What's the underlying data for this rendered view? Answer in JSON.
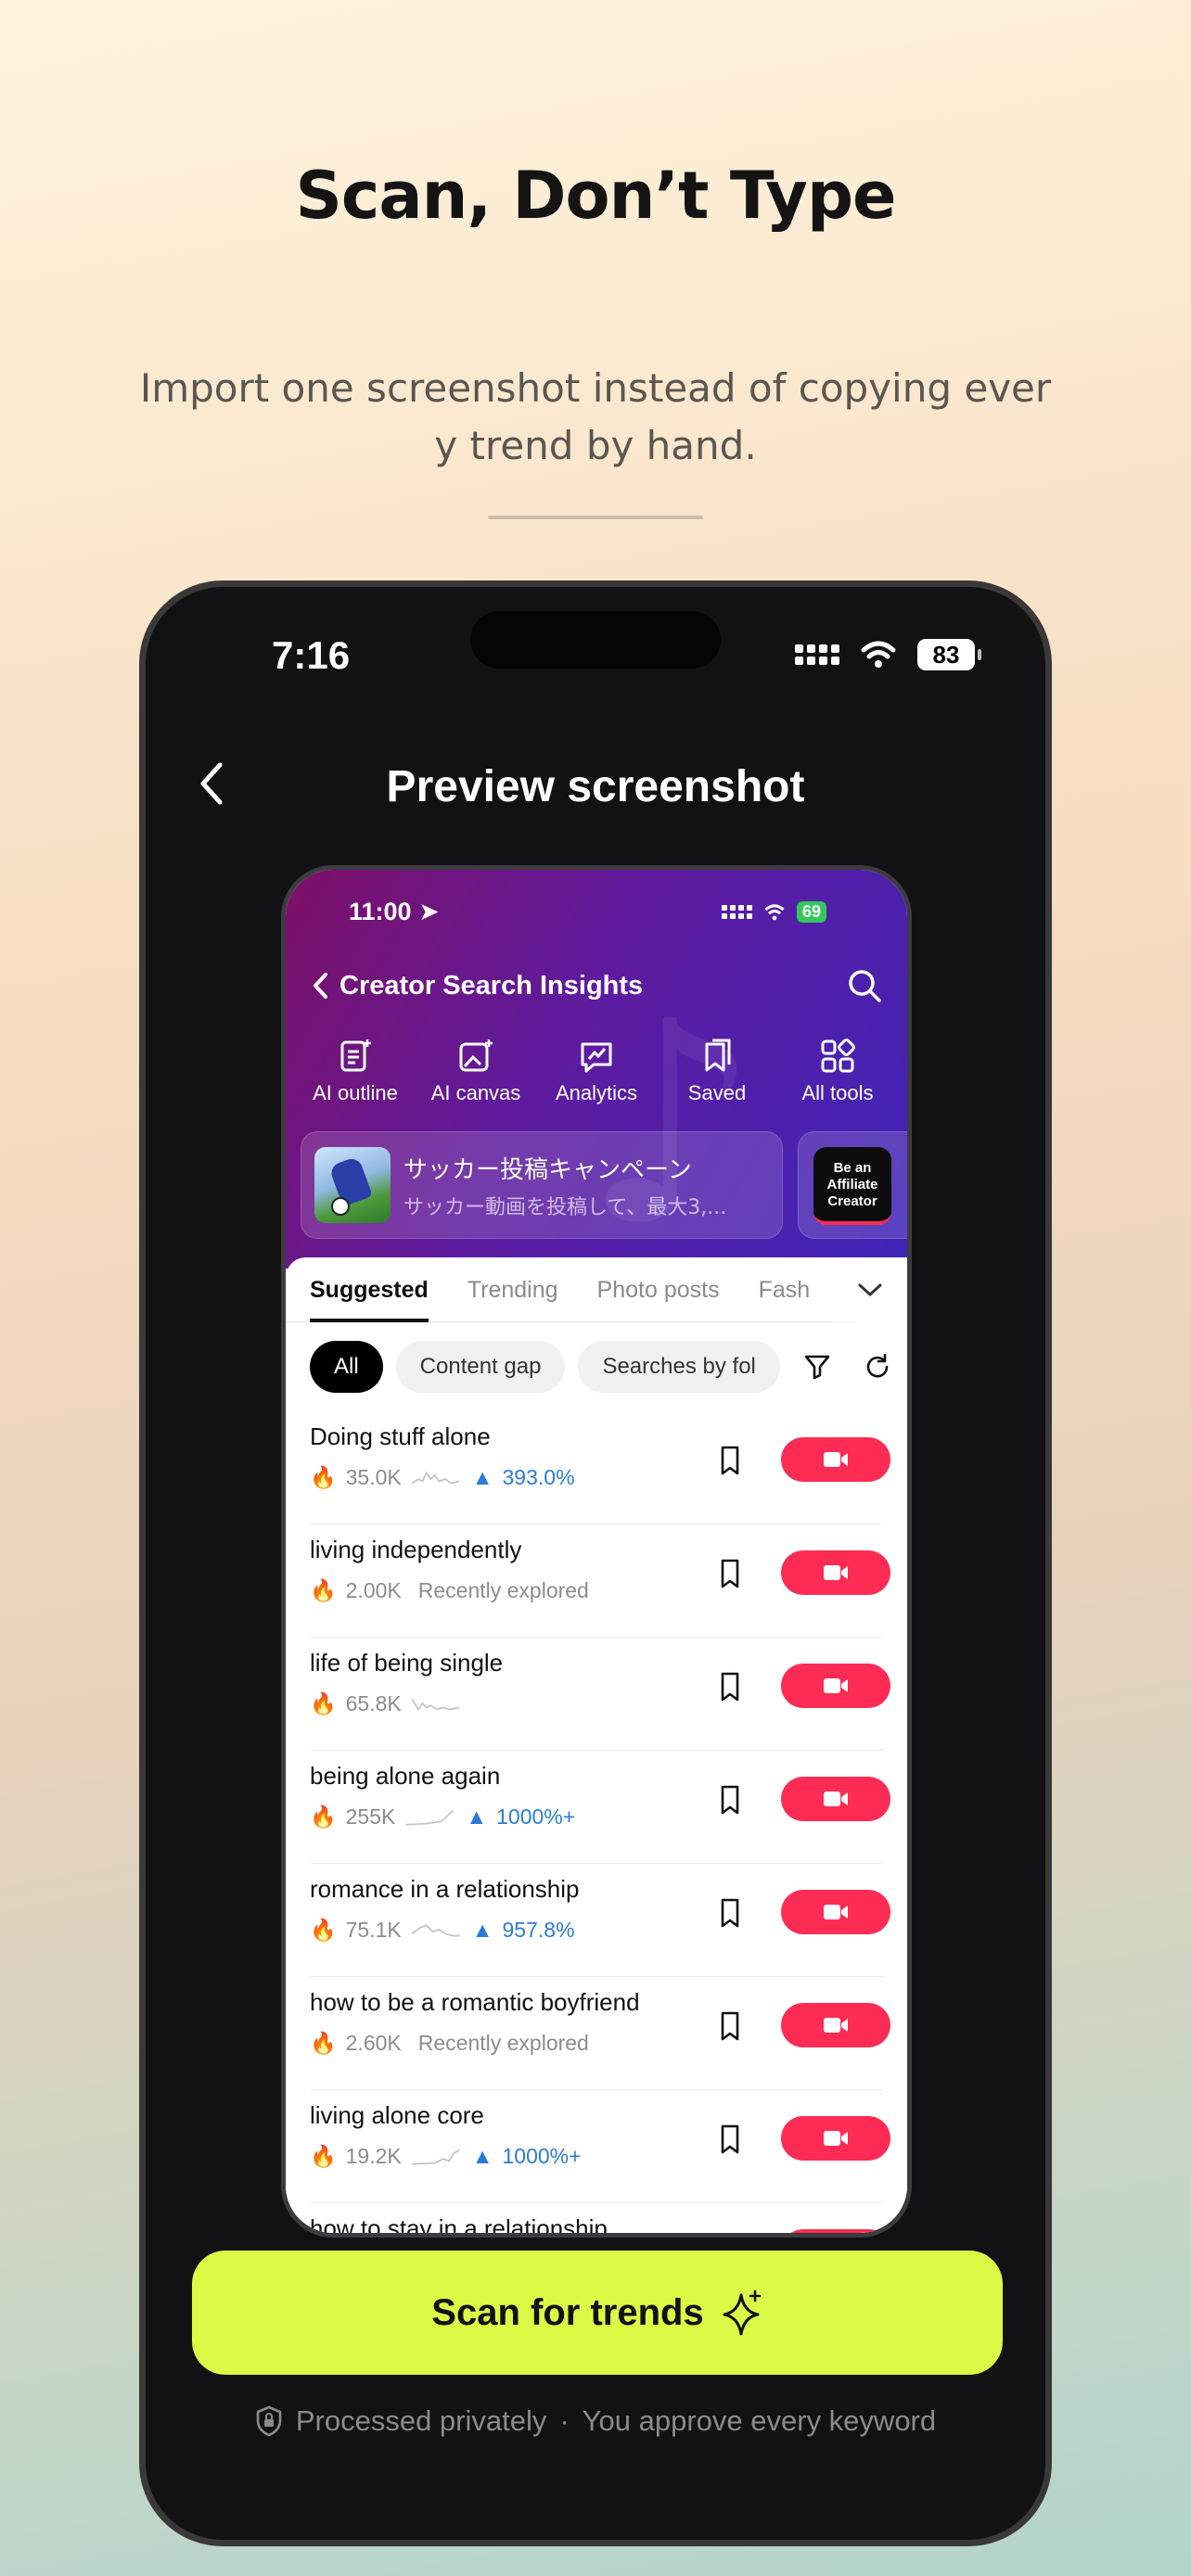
{
  "marketing": {
    "headline": "Scan, Don’t Type",
    "subhead": "Import one screenshot instead of copying every trend by hand."
  },
  "phone": {
    "time": "7:16",
    "battery": "83",
    "title": "Preview screenshot"
  },
  "screenshot": {
    "time": "11:00",
    "battery": "69",
    "title": "Creator Search Insights",
    "tools": [
      {
        "label": "AI outline",
        "icon": "ai-outline-icon"
      },
      {
        "label": "AI canvas",
        "icon": "ai-canvas-icon"
      },
      {
        "label": "Analytics",
        "icon": "analytics-icon"
      },
      {
        "label": "Saved",
        "icon": "saved-icon"
      },
      {
        "label": "All tools",
        "icon": "all-tools-icon"
      }
    ],
    "banner": {
      "title": "サッカー投稿キャンペーン",
      "subtitle": "サッカー動画を投稿して、最大3,..."
    },
    "banner2_text": "Be an Affiliate Creator",
    "tabs": [
      "Suggested",
      "Trending",
      "Photo posts",
      "Fash"
    ],
    "filters": [
      "All",
      "Content gap",
      "Searches by fol"
    ],
    "rows": [
      {
        "keyword": "Doing stuff alone",
        "count": "35.0K",
        "trend": "393.0%"
      },
      {
        "keyword": "living independently",
        "count": "2.00K",
        "note": "Recently explored"
      },
      {
        "keyword": "life of being single",
        "count": "65.8K"
      },
      {
        "keyword": "being alone again",
        "count": "255K",
        "trend": "1000%+"
      },
      {
        "keyword": "romance in a relationship",
        "count": "75.1K",
        "trend": "957.8%"
      },
      {
        "keyword": "how to be a romantic boyfriend",
        "count": "2.60K",
        "note": "Recently explored"
      },
      {
        "keyword": "living alone core",
        "count": "19.2K",
        "trend": "1000%+"
      },
      {
        "keyword": "how to stay in a relationship",
        "count": ""
      }
    ]
  },
  "cta": {
    "label": "Scan for trends"
  },
  "privacy": {
    "left": "Processed privately",
    "separator": "·",
    "right": "You approve every keyword"
  },
  "colors": {
    "accent": "#dafa45",
    "record": "#fe2c55",
    "trend": "#2b7bd6"
  }
}
